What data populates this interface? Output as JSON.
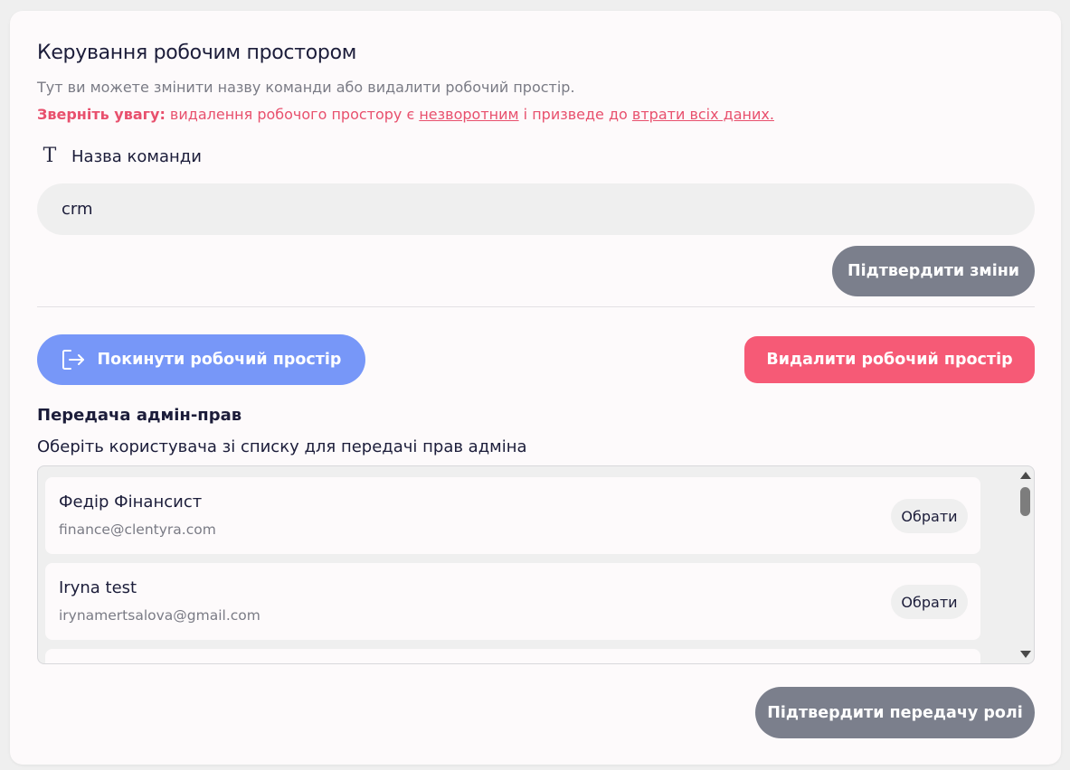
{
  "workspace": {
    "title": "Керування робочим простором",
    "subtitle": "Тут ви можете змінити назву команди або видалити робочий простір.",
    "warning": {
      "prefix": "Зверніть увагу:",
      "text1": " видалення робочого простору є ",
      "link1": "незворотним",
      "text2": " і призведе до ",
      "link2": "втрати всіх даних."
    },
    "team_name_label": "Назва команди",
    "team_name_value": "crm",
    "confirm_changes_label": "Підтвердити зміни",
    "leave_label": "Покинути робочий простір",
    "delete_label": "Видалити робочий простір"
  },
  "admin_transfer": {
    "title": "Передача адмін-прав",
    "description": "Оберіть користувача зі списку для передачі прав адміна",
    "users": [
      {
        "name": "Федір Фінансист",
        "email": "finance@clentyra.com",
        "select_label": "Обрати"
      },
      {
        "name": "Iryna test",
        "email": "irynamertsalova@gmail.com",
        "select_label": "Обрати"
      }
    ],
    "confirm_label": "Підтвердити передачу ролі"
  },
  "icons": {
    "team_name": "text-type-icon",
    "leave": "exit-icon"
  },
  "colors": {
    "primary_blue": "#7797f8",
    "danger": "#f65a76",
    "warning_text": "#e8506d",
    "neutral_button": "#7b7f8c"
  }
}
